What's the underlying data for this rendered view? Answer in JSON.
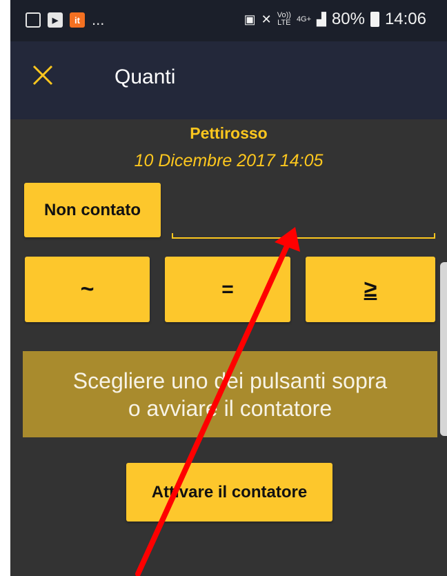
{
  "status_bar": {
    "notif_dots": "...",
    "network_top": "Vo))",
    "network_bottom": "LTE",
    "signal_type": "4G+",
    "battery": "80%",
    "time": "14:06"
  },
  "app_bar": {
    "title": "Quanti",
    "close_icon": "close-icon"
  },
  "record": {
    "species": "Pettirosso",
    "datetime": "10 Dicembre 2017 14:05"
  },
  "buttons": {
    "not_counted": "Non contato",
    "approx": "~",
    "equal": "=",
    "greater_equal": "≥",
    "start_counter": "Attivare il contatore"
  },
  "count_value": "",
  "info": {
    "line1": "Scegliere uno dei pulsanti sopra",
    "line2": "o avviare il contatore"
  },
  "colors": {
    "accent": "#fdc72c",
    "background": "#333333",
    "app_bar": "#23283a",
    "info_box": "#a98b2d",
    "annotation_arrow": "#ff0000"
  }
}
